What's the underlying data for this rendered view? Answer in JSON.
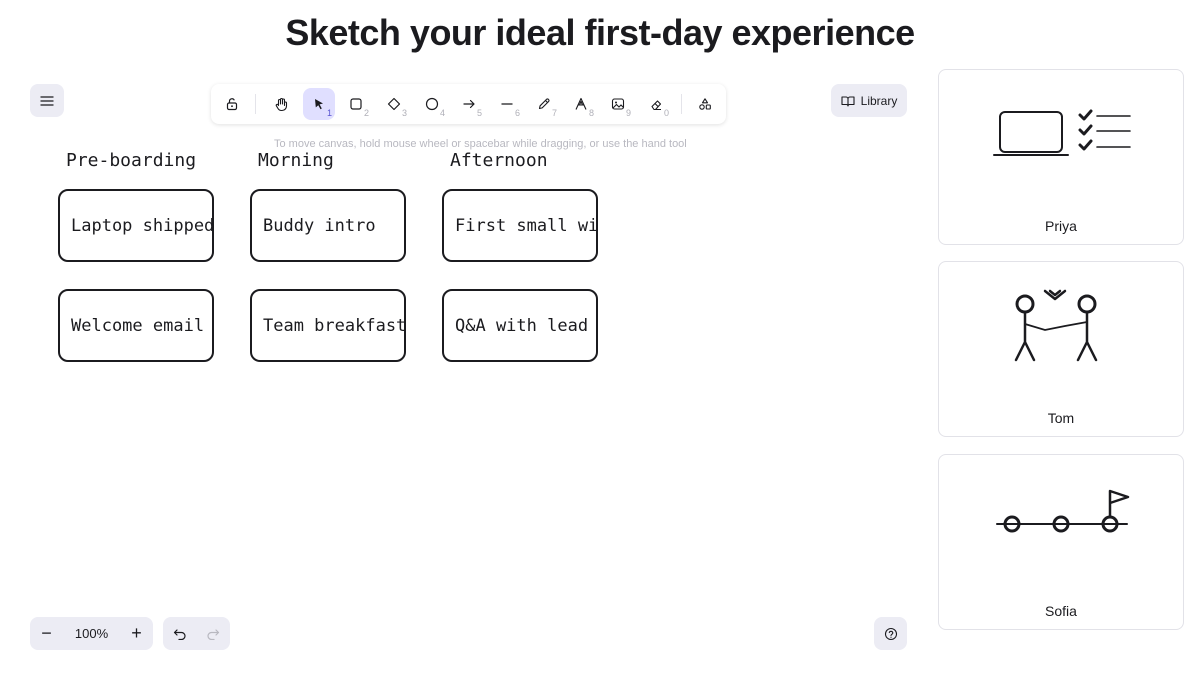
{
  "title": "Sketch your ideal first-day experience",
  "toolbar": {
    "tools": [
      {
        "name": "lock-icon",
        "key": ""
      },
      {
        "name": "hand-icon",
        "key": ""
      },
      {
        "name": "selection-icon",
        "key": "1",
        "active": true
      },
      {
        "name": "rectangle-icon",
        "key": "2"
      },
      {
        "name": "diamond-icon",
        "key": "3"
      },
      {
        "name": "ellipse-icon",
        "key": "4"
      },
      {
        "name": "arrow-icon",
        "key": "5"
      },
      {
        "name": "line-icon",
        "key": "6"
      },
      {
        "name": "pencil-icon",
        "key": "7"
      },
      {
        "name": "text-icon",
        "key": "8"
      },
      {
        "name": "image-icon",
        "key": "9"
      },
      {
        "name": "eraser-icon",
        "key": "0"
      },
      {
        "name": "extra-tools-icon",
        "key": ""
      }
    ]
  },
  "hint": "To move canvas, hold mouse wheel or spacebar while dragging, or use the hand tool",
  "library_label": "Library",
  "columns": [
    {
      "label": "Pre-boarding",
      "cards": [
        "Laptop shipped",
        "Welcome email"
      ]
    },
    {
      "label": "Morning",
      "cards": [
        "Buddy intro",
        "Team breakfast"
      ]
    },
    {
      "label": "Afternoon",
      "cards": [
        "First small win",
        "Q&A with lead"
      ]
    }
  ],
  "zoom": {
    "value": "100%",
    "minus": "−",
    "plus": "+"
  },
  "participants": [
    {
      "name": "Priya",
      "sketch": "laptop-checklist-sketch"
    },
    {
      "name": "Tom",
      "sketch": "handshake-sketch"
    },
    {
      "name": "Sofia",
      "sketch": "timeline-flag-sketch"
    }
  ]
}
